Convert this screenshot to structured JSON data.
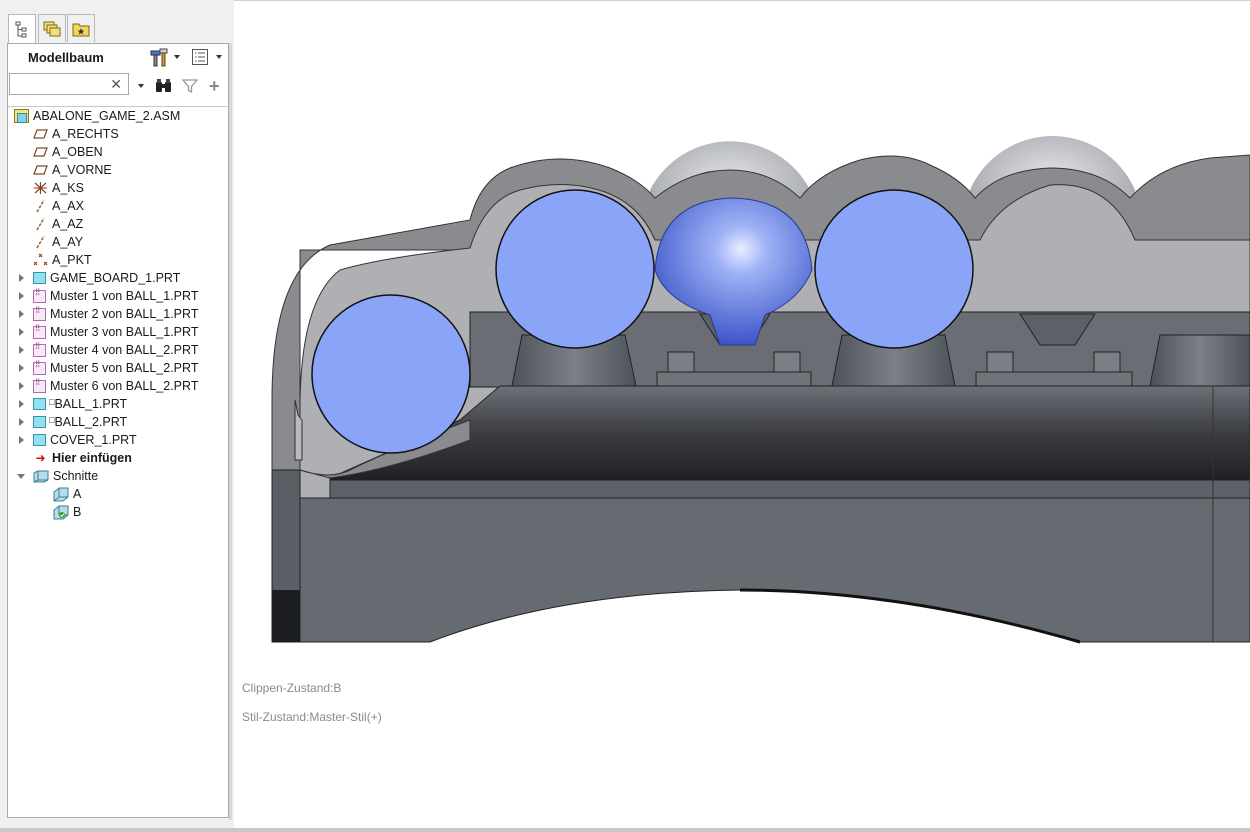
{
  "panel": {
    "title": "Modellbaum",
    "tabs": [
      {
        "name": "tree-icon"
      },
      {
        "name": "layers-icon"
      },
      {
        "name": "favorites-icon"
      }
    ],
    "search": {
      "value": "",
      "placeholder": "",
      "clear": "✕"
    },
    "add_symbol": "+"
  },
  "tree": {
    "root": "ABALONE_GAME_2.ASM",
    "items": [
      {
        "label": "A_RECHTS",
        "icon": "datum-plane-icon"
      },
      {
        "label": "A_OBEN",
        "icon": "datum-plane-icon"
      },
      {
        "label": "A_VORNE",
        "icon": "datum-plane-icon"
      },
      {
        "label": "A_KS",
        "icon": "coordinate-system-icon"
      },
      {
        "label": "A_AX",
        "icon": "datum-axis-icon"
      },
      {
        "label": "A_AZ",
        "icon": "datum-axis-icon"
      },
      {
        "label": "A_AY",
        "icon": "datum-axis-icon"
      },
      {
        "label": "A_PKT",
        "icon": "datum-point-icon"
      },
      {
        "label": "GAME_BOARD_1.PRT",
        "icon": "part-icon"
      },
      {
        "label": "Muster 1 von BALL_1.PRT",
        "icon": "pattern-icon"
      },
      {
        "label": "Muster 2 von BALL_1.PRT",
        "icon": "pattern-icon"
      },
      {
        "label": "Muster 3 von BALL_1.PRT",
        "icon": "pattern-icon"
      },
      {
        "label": "Muster 4 von BALL_2.PRT",
        "icon": "pattern-icon"
      },
      {
        "label": "Muster 5 von BALL_2.PRT",
        "icon": "pattern-icon"
      },
      {
        "label": "Muster 6 von BALL_2.PRT",
        "icon": "pattern-icon"
      },
      {
        "label": "BALL_1.PRT",
        "prefix": "□",
        "icon": "part-icon"
      },
      {
        "label": "BALL_2.PRT",
        "prefix": "□",
        "icon": "part-icon"
      },
      {
        "label": "COVER_1.PRT",
        "icon": "part-icon"
      },
      {
        "label": "Hier einfügen",
        "icon": "insert-arrow-icon"
      },
      {
        "label": "Schnitte",
        "icon": "sections-folder-icon"
      },
      {
        "label": "A",
        "icon": "section-icon"
      },
      {
        "label": "B",
        "icon": "active-section-icon"
      }
    ]
  },
  "viewport": {
    "clip_status": "Clippen-Zustand:B",
    "style_status": "Stil-Zustand:Master-Stil(+)"
  },
  "colors": {
    "ball": "#8aa4f8",
    "cover": "#8c8c8c",
    "board_dark": "#3a3d42",
    "board_base": "#6b7079"
  }
}
